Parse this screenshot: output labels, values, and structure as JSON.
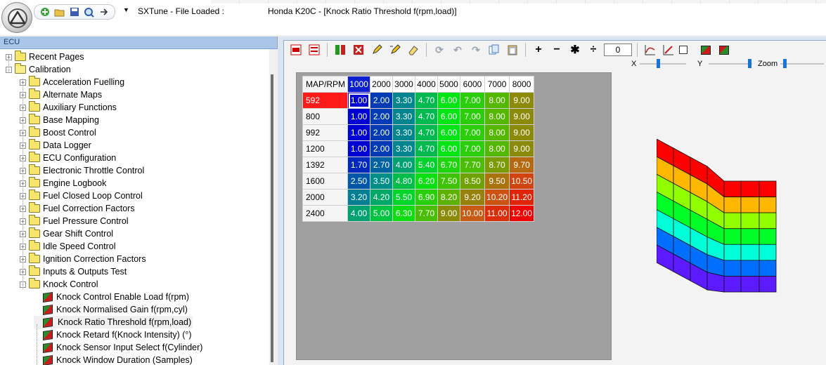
{
  "title": {
    "app": "SXTune - File Loaded :",
    "document": "Honda K20C - [Knock Ratio Threshold f(rpm,load)]"
  },
  "quick_access": [
    "add-icon",
    "open-folder-icon",
    "save-icon",
    "zoom-icon",
    "forward-icon"
  ],
  "left_pane": {
    "header": "ECU",
    "tree": [
      {
        "label": "Recent Pages",
        "depth": 0,
        "kind": "folder",
        "expander": "+"
      },
      {
        "label": "Calibration",
        "depth": 0,
        "kind": "folder-open",
        "expander": "-"
      },
      {
        "label": "Acceleration Fuelling",
        "depth": 1,
        "kind": "folder",
        "expander": "+"
      },
      {
        "label": "Alternate Maps",
        "depth": 1,
        "kind": "folder",
        "expander": "+"
      },
      {
        "label": "Auxiliary Functions",
        "depth": 1,
        "kind": "folder",
        "expander": "+"
      },
      {
        "label": "Base Mapping",
        "depth": 1,
        "kind": "folder",
        "expander": "+"
      },
      {
        "label": "Boost Control",
        "depth": 1,
        "kind": "folder",
        "expander": "+"
      },
      {
        "label": "Data Logger",
        "depth": 1,
        "kind": "folder",
        "expander": "+"
      },
      {
        "label": "ECU Configuration",
        "depth": 1,
        "kind": "folder",
        "expander": "+"
      },
      {
        "label": "Electronic Throttle Control",
        "depth": 1,
        "kind": "folder",
        "expander": "+"
      },
      {
        "label": "Engine Logbook",
        "depth": 1,
        "kind": "folder",
        "expander": "+"
      },
      {
        "label": "Fuel Closed Loop Control",
        "depth": 1,
        "kind": "folder",
        "expander": "+"
      },
      {
        "label": "Fuel Correction Factors",
        "depth": 1,
        "kind": "folder",
        "expander": "+"
      },
      {
        "label": "Fuel Pressure Control",
        "depth": 1,
        "kind": "folder",
        "expander": "+"
      },
      {
        "label": "Gear Shift Control",
        "depth": 1,
        "kind": "folder",
        "expander": "+"
      },
      {
        "label": "Idle Speed Control",
        "depth": 1,
        "kind": "folder",
        "expander": "+"
      },
      {
        "label": "Ignition Correction Factors",
        "depth": 1,
        "kind": "folder",
        "expander": "+"
      },
      {
        "label": "Inputs & Outputs Test",
        "depth": 1,
        "kind": "folder",
        "expander": "+"
      },
      {
        "label": "Knock Control",
        "depth": 1,
        "kind": "folder",
        "expander": "-"
      },
      {
        "label": "Knock Control Enable Load f(rpm)",
        "depth": 2,
        "kind": "map"
      },
      {
        "label": "Knock Normalised Gain f(rpm,cyl)",
        "depth": 2,
        "kind": "map"
      },
      {
        "label": "Knock Ratio Threshold f(rpm,load)",
        "depth": 2,
        "kind": "map",
        "selected": true
      },
      {
        "label": "Knock Retard f(Knock Intensity) (°)",
        "depth": 2,
        "kind": "map"
      },
      {
        "label": "Knock Sensor Input Select f(Cylinder)",
        "depth": 2,
        "kind": "map"
      },
      {
        "label": "Knock Window Duration (Samples)",
        "depth": 2,
        "kind": "map"
      }
    ]
  },
  "toolbar": {
    "value_input": "0",
    "slider_x": "X",
    "slider_y": "Y",
    "slider_zoom": "Zoom",
    "symbols": {
      "plus": "+",
      "minus": "−",
      "multiply": "✱",
      "divide": "÷"
    }
  },
  "map_table": {
    "corner": "MAP/RPM",
    "columns": [
      "1000",
      "2000",
      "3000",
      "4000",
      "5000",
      "6000",
      "7000",
      "8000"
    ],
    "rows": [
      {
        "label": "592",
        "values": [
          "1.00",
          "2.00",
          "3.30",
          "4.70",
          "6.00",
          "7.00",
          "8.00",
          "9.00"
        ]
      },
      {
        "label": "800",
        "values": [
          "1.00",
          "2.00",
          "3.30",
          "4.70",
          "6.00",
          "7.00",
          "8.00",
          "9.00"
        ]
      },
      {
        "label": "992",
        "values": [
          "1.00",
          "2.00",
          "3.30",
          "4.70",
          "6.00",
          "7.00",
          "8.00",
          "9.00"
        ]
      },
      {
        "label": "1200",
        "values": [
          "1.00",
          "2.00",
          "3.30",
          "4.70",
          "6.00",
          "7.00",
          "8.00",
          "9.00"
        ]
      },
      {
        "label": "1392",
        "values": [
          "1.70",
          "2.70",
          "4.00",
          "5.40",
          "6.70",
          "7.70",
          "8.70",
          "9.70"
        ]
      },
      {
        "label": "1600",
        "values": [
          "2.50",
          "3.50",
          "4.80",
          "6.20",
          "7.50",
          "8.50",
          "9.50",
          "10.50"
        ]
      },
      {
        "label": "2000",
        "values": [
          "3.20",
          "4.20",
          "5.50",
          "6.90",
          "8.20",
          "9.20",
          "10.20",
          "11.20"
        ]
      },
      {
        "label": "2400",
        "values": [
          "4.00",
          "5.00",
          "6.30",
          "7.70",
          "9.00",
          "10.00",
          "11.00",
          "12.00"
        ]
      }
    ],
    "active_column": 0,
    "active_row": 0,
    "selected_cell": [
      0,
      0
    ],
    "value_range": [
      1.0,
      12.0
    ]
  }
}
